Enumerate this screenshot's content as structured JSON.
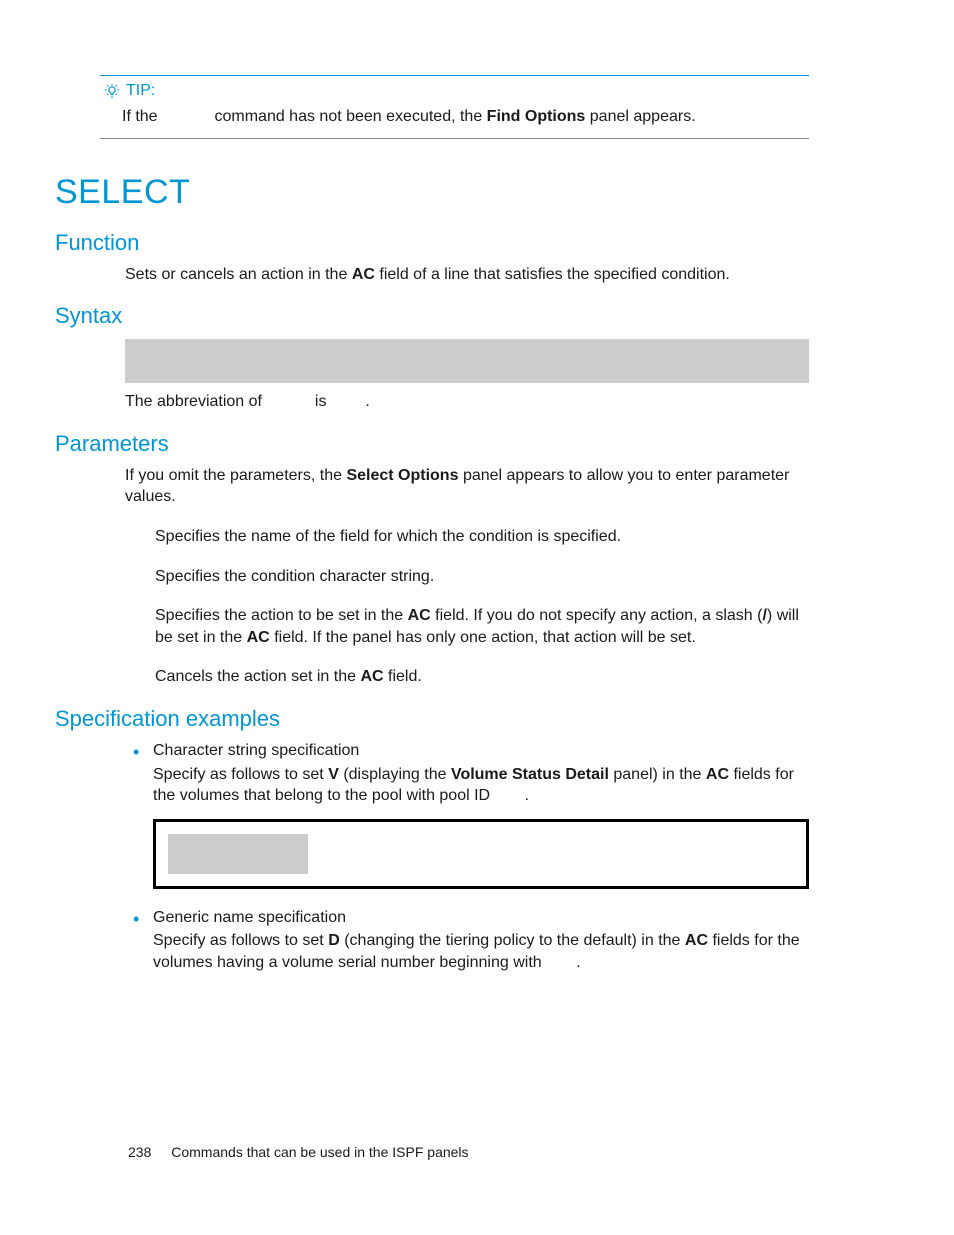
{
  "tip": {
    "label": "TIP:",
    "line_prefix": "If the",
    "line_mid": "command has not been executed, the",
    "bold": "Find Options",
    "line_suffix": "panel appears."
  },
  "h1": "SELECT",
  "function": {
    "heading": "Function",
    "text_a": "Sets or cancels an action in the",
    "bold": "AC",
    "text_b": "field of a line that satisfies the specified condition."
  },
  "syntax": {
    "heading": "Syntax",
    "abbrev_a": "The abbreviation of",
    "abbrev_b": "is",
    "abbrev_c": "."
  },
  "parameters": {
    "heading": "Parameters",
    "intro_a": "If you omit the parameters, the",
    "intro_bold": "Select Options",
    "intro_b": "panel appears to allow you to enter parameter values.",
    "p1": "Specifies the name of the field for which the condition is specified.",
    "p2": "Specifies the condition character string.",
    "p3_a": "Specifies the action to be set in the",
    "p3_bold1": "AC",
    "p3_b": "field. If you do not specify any action, a slash (",
    "p3_bold2": "/",
    "p3_c": ") will be set in the",
    "p3_bold3": "AC",
    "p3_d": "field. If the panel has only one action, that action will be set.",
    "p4_a": "Cancels the action set in the",
    "p4_bold": "AC",
    "p4_b": "field."
  },
  "spec": {
    "heading": "Specification examples",
    "item1": {
      "title": "Character string specification",
      "d_a": "Specify as follows to set",
      "d_bold1": "V",
      "d_b": "(displaying the",
      "d_bold2": "Volume Status Detail",
      "d_c": "panel) in the",
      "d_bold3": "AC",
      "d_d": "fields for the volumes that belong to the pool with pool ID",
      "d_e": "."
    },
    "item2": {
      "title": "Generic name specification",
      "d_a": "Specify as follows to set",
      "d_bold1": "D",
      "d_b": "(changing the tiering policy to the default) in the",
      "d_bold2": "AC",
      "d_c": "fields for the volumes having a volume serial number beginning with",
      "d_d": "."
    }
  },
  "footer": {
    "page": "238",
    "text": "Commands that can be used in the ISPF panels"
  }
}
